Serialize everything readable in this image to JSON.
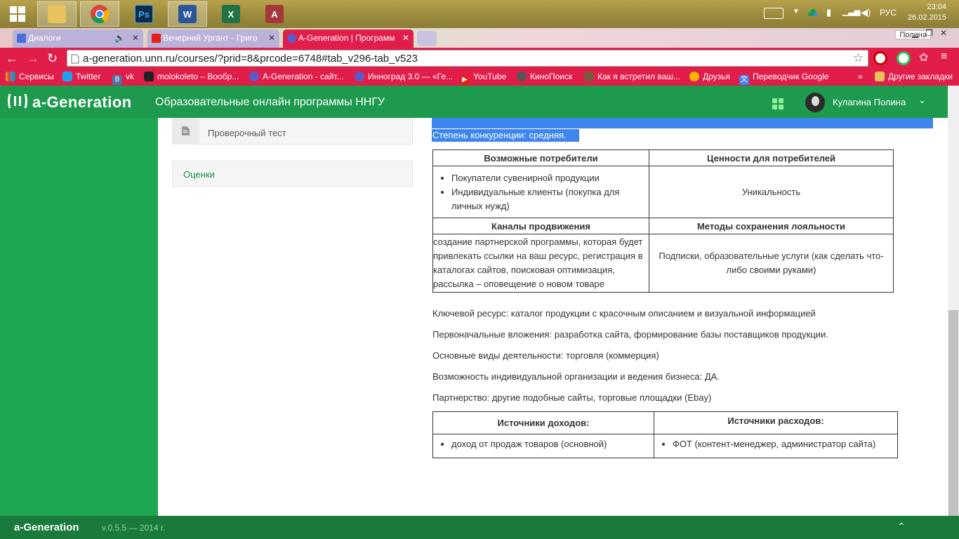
{
  "taskbar": {
    "apps": [
      "windows-start",
      "file-explorer",
      "chrome",
      "photoshop",
      "word",
      "excel",
      "access"
    ],
    "app_letters": {
      "photoshop": "Ps",
      "word": "W",
      "excel": "X",
      "access": "A"
    },
    "lang": "РУС",
    "time": "23:04",
    "date": "26.02.2015"
  },
  "browser": {
    "tabs": [
      {
        "label": "Диалоги",
        "active": false
      },
      {
        "label": "Вечерний Ургант - Григо",
        "active": false
      },
      {
        "label": "A-Generation | Программ",
        "active": true
      }
    ],
    "profile": "Полина",
    "url": "a-generation.unn.ru/courses/?prid=8&prcode=6748#tab_v296-tab_v523",
    "bookmarks": [
      "Сервисы",
      "Twitter",
      "vk",
      "molokoleto – Вообр...",
      "A-Generation - сайт...",
      "Инноград 3.0 — «Ге...",
      "YouTube",
      "КиноПоиск",
      "Как я встретил ваш...",
      "Друзья",
      "Переводчик Google"
    ],
    "bookmarks_more": "»",
    "other_bookmarks": "Другие закладки"
  },
  "header": {
    "logo": "a-Generation",
    "title": "Образовательные онлайн программы ННГУ",
    "user": "Кулагина Полина"
  },
  "sidebar": {
    "items": [
      "Проверочный тест",
      "Оценки"
    ]
  },
  "main": {
    "competition": "Степень конкуренции: средняя.",
    "table1": {
      "h_consumers": "Возможные потребители",
      "h_values": "Ценности для потребителей",
      "consumers": [
        "Покупатели сувенирной продукции",
        "Индивидуальные клиенты (покупка для личных нужд)"
      ],
      "values": "Уникальность",
      "h_channels": "Каналы продвижения",
      "h_loyalty": "Методы сохранения лояльности",
      "channels": "создание партнерской программы, которая будет привлекать ссылки на ваш ресурс, регистрация в каталогах сайтов, поисковая оптимизация, рассылка – оповещение о новом товаре",
      "loyalty": "Подписки, образовательные услуги (как сделать что-либо своими руками)"
    },
    "paragraphs": [
      "Ключевой ресурс: каталог продукции с красочным описанием и визуальной информацией",
      "Первоначальные вложения: разработка сайта, формирование базы поставщиков продукции.",
      "Основные виды деятельности: торговля (коммерция)",
      "Возможность индивидуальной организации и ведения бизнеса: ДА.",
      "Партнерство: другие подобные сайты, торговые площадки (Ebay)"
    ],
    "table2": {
      "h_income": "Источники доходов:",
      "h_expenses": "Источники расходов:",
      "income": "доход от продаж товаров (основной)",
      "expenses": "ФОТ (контент-менеджер, администратор сайта)"
    }
  },
  "footer": {
    "logo": "a-Generation",
    "version": "v.0.5.5 — 2014 г."
  },
  "colors": {
    "brand_green": "#1d9a4d",
    "browser_red": "#e01e49",
    "selection_blue": "#3e86ee"
  }
}
